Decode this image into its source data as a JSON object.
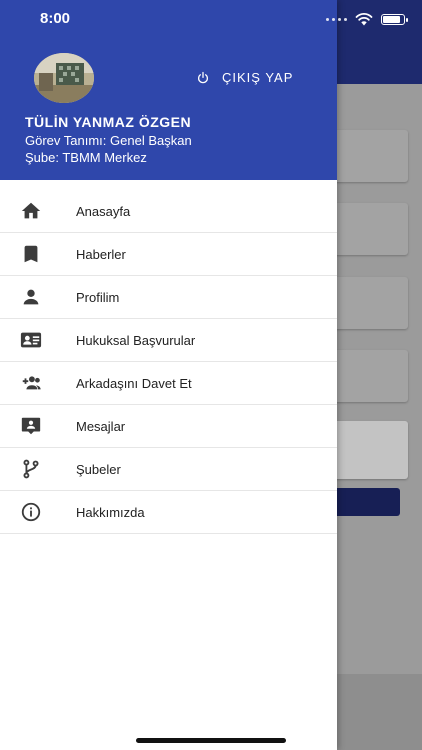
{
  "status_bar": {
    "time": "8:00"
  },
  "drawer": {
    "header_color": "#2f47ab",
    "logout_label": "ÇIKIŞ YAP",
    "user": {
      "name": "TÜLİN YANMAZ ÖZGEN",
      "role": "Görev Tanımı: Genel Başkan",
      "branch": "Şube: TBMM Merkez"
    },
    "menu": [
      {
        "label": "Anasayfa",
        "icon": "home-icon"
      },
      {
        "label": "Haberler",
        "icon": "bookmark-icon"
      },
      {
        "label": "Profilim",
        "icon": "person-icon"
      },
      {
        "label": "Hukuksal Başvurular",
        "icon": "contact-card-icon"
      },
      {
        "label": "Arkadaşını Davet Et",
        "icon": "group-add-icon"
      },
      {
        "label": "Mesajlar",
        "icon": "message-icon"
      },
      {
        "label": "Şubeler",
        "icon": "branch-icon"
      },
      {
        "label": "Hakkımızda",
        "icon": "info-icon"
      }
    ]
  },
  "colors": {
    "app_bar": "#1e2a6e",
    "overlay": "#9b9b9b",
    "icon": "#3c3c3c"
  }
}
